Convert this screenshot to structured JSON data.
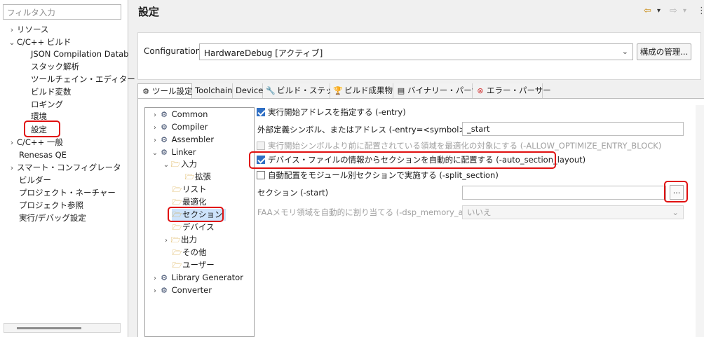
{
  "filter": {
    "placeholder": "フィルタ入力"
  },
  "nav": [
    {
      "label": "リソース",
      "chevron": "›"
    },
    {
      "label": "C/C++ ビルド",
      "chevron": "⌄"
    },
    {
      "label": "JSON Compilation Datab"
    },
    {
      "label": "スタック解析"
    },
    {
      "label": "ツールチェイン・エディター"
    },
    {
      "label": "ビルド変数"
    },
    {
      "label": "ロギング"
    },
    {
      "label": "環境"
    },
    {
      "label": "設定"
    },
    {
      "label": "C/C++ 一般",
      "chevron": "›"
    },
    {
      "label": "Renesas QE"
    },
    {
      "label": "スマート・コンフィグレータ",
      "chevron": "›"
    },
    {
      "label": "ビルダー"
    },
    {
      "label": "プロジェクト・ネーチャー"
    },
    {
      "label": "プロジェクト参照"
    },
    {
      "label": "実行/デバッグ設定"
    }
  ],
  "page_title": "設定",
  "header_nav": {
    "back": "⇦",
    "dropdown": "▾",
    "forward": "⇨",
    "menu": "⋮"
  },
  "config": {
    "label": "Configuration:",
    "value": "HardwareDebug [アクティブ]",
    "arrow": "⌄",
    "manage": "構成の管理..."
  },
  "tabs": [
    {
      "label": "ツール設定",
      "icon": "gear-icon",
      "glyph": "⚙"
    },
    {
      "label": "Toolchain"
    },
    {
      "label": "Device"
    },
    {
      "label": "ビルド・ステップ",
      "icon": "wrench-icon",
      "glyph": "🔧"
    },
    {
      "label": "ビルド成果物",
      "icon": "trophy-icon",
      "glyph": "🏆"
    },
    {
      "label": "バイナリー・パーサー",
      "icon": "binary-icon",
      "glyph": "▤"
    },
    {
      "label": "エラー・パーサー",
      "icon": "error-icon",
      "glyph": "⊗"
    }
  ],
  "tree": [
    {
      "label": "Common",
      "chevron": "›"
    },
    {
      "label": "Compiler",
      "chevron": "›"
    },
    {
      "label": "Assembler",
      "chevron": "›"
    },
    {
      "label": "Linker",
      "chevron": "⌄"
    },
    {
      "label": "入力",
      "chevron": "⌄"
    },
    {
      "label": "拡張"
    },
    {
      "label": "リスト"
    },
    {
      "label": "最適化"
    },
    {
      "label": "セクション"
    },
    {
      "label": "デバイス"
    },
    {
      "label": "出力",
      "chevron": "›"
    },
    {
      "label": "その他"
    },
    {
      "label": "ユーザー"
    },
    {
      "label": "Library Generator",
      "chevron": "›"
    },
    {
      "label": "Converter",
      "chevron": "›"
    }
  ],
  "settings": {
    "entry": "実行開始アドレスを指定する (-entry)",
    "entry_symbol_label": "外部定義シンボル、またはアドレス (-entry=<symbol>)",
    "entry_symbol_value": "_start",
    "allow_optimize": "実行開始シンボルより前に配置されている領域を最適化の対象にする (-ALLOW_OPTIMIZE_ENTRY_BLOCK)",
    "auto_section": "デバイス・ファイルの情報からセクションを自動的に配置する (-auto_section_layout)",
    "split_section": "自動配置をモジュール別セクションで実施する (-split_section)",
    "start_label": "セクション (-start)",
    "start_value": "",
    "browse": "...",
    "dsp_label": "FAAメモリ領域を自動的に割り当てる (-dsp_memory_area)",
    "dsp_value": "いいえ",
    "dsp_arrow": "⌄"
  },
  "colors": {
    "highlight": "#e01010",
    "checkbox_on": "#2f6fc4"
  }
}
